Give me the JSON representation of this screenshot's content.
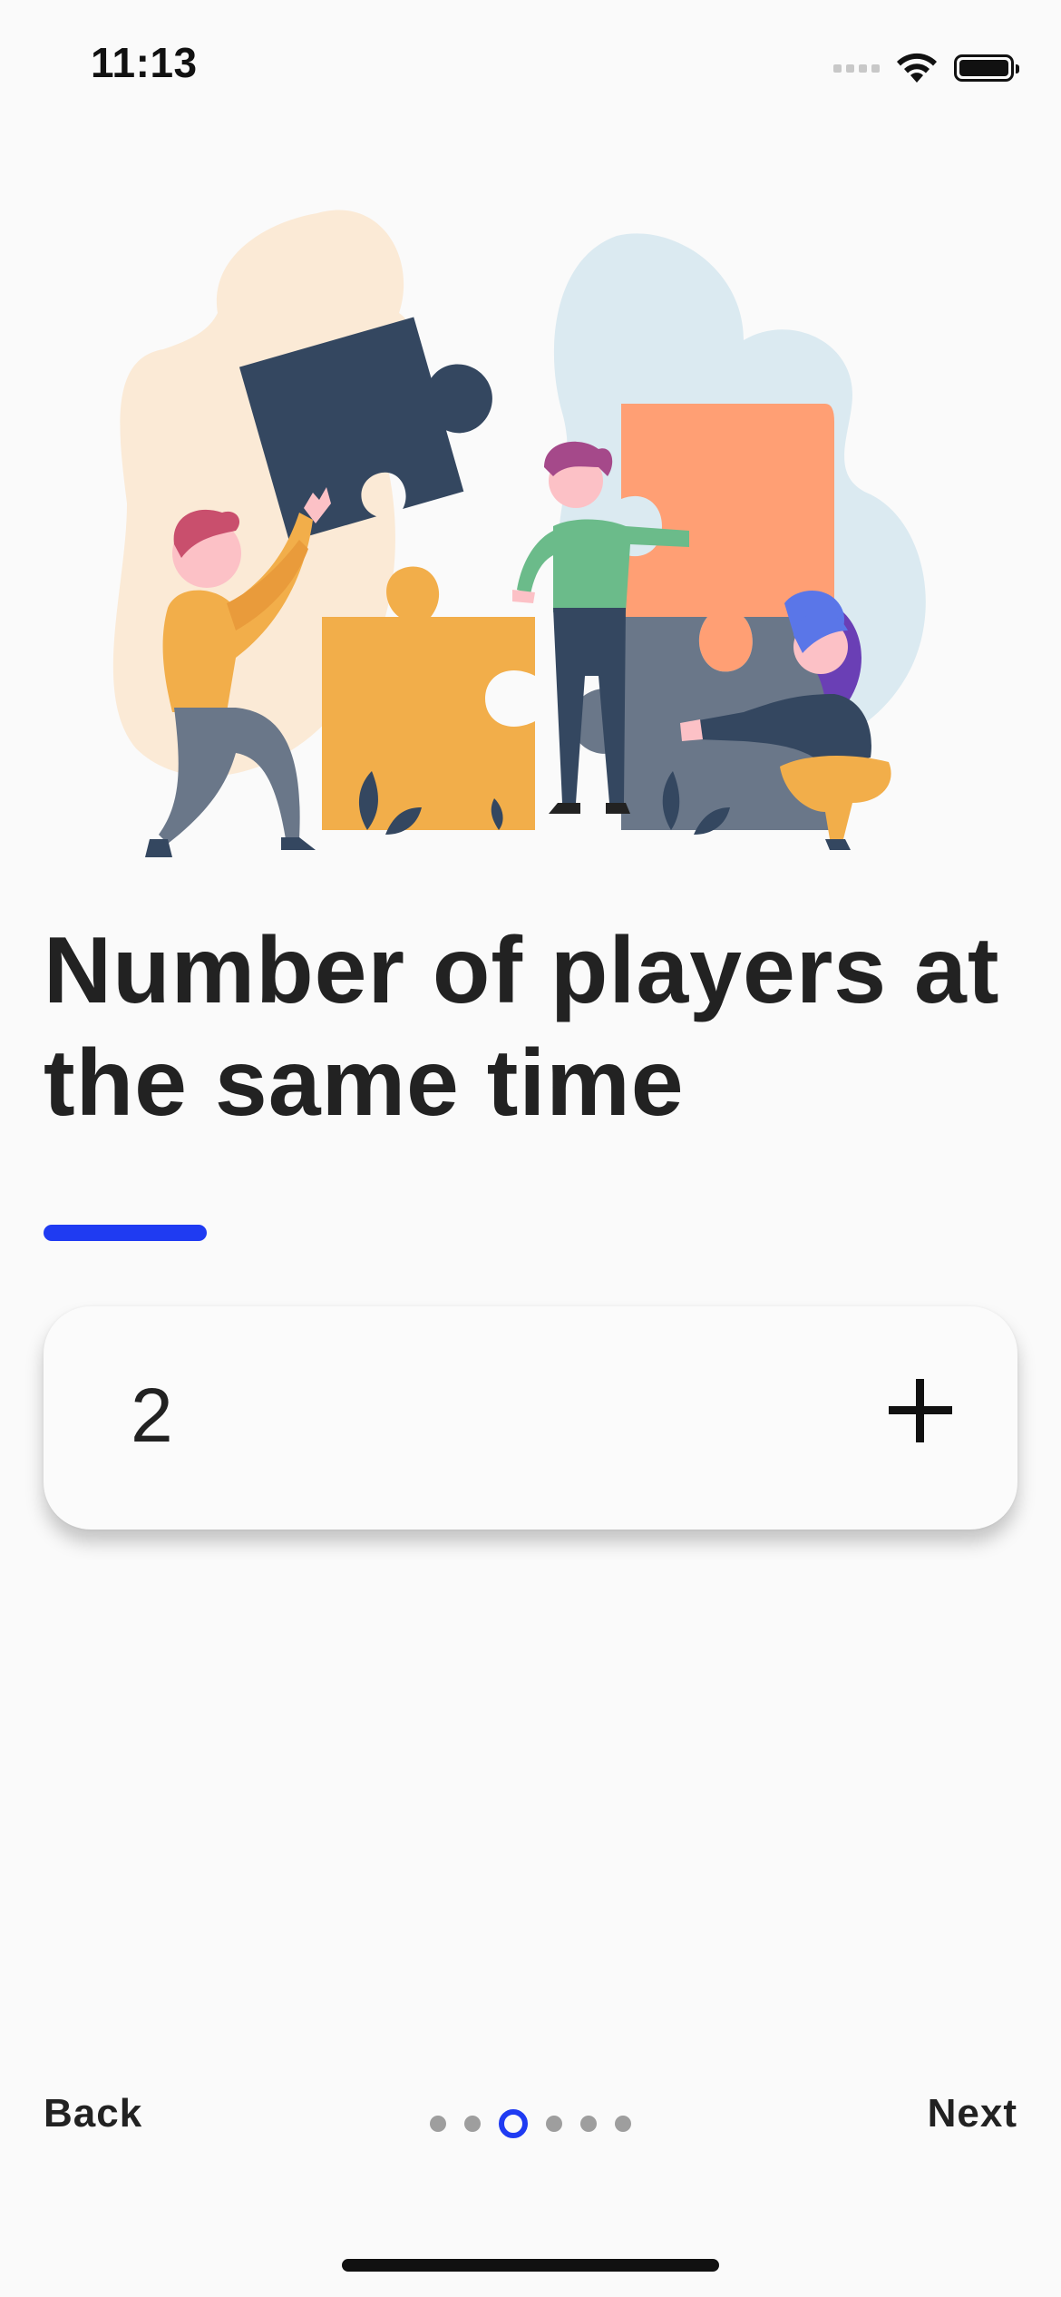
{
  "status_bar": {
    "time": "11:13"
  },
  "onboarding": {
    "title": "Number of players at the same time",
    "accent_color": "#1f3bf2",
    "illustration_icon": "people-assembling-puzzle-illustration"
  },
  "stepper": {
    "value": "2",
    "increment_icon": "plus-icon"
  },
  "navigation": {
    "back_label": "Back",
    "next_label": "Next",
    "page_count": 6,
    "current_page": 3
  }
}
